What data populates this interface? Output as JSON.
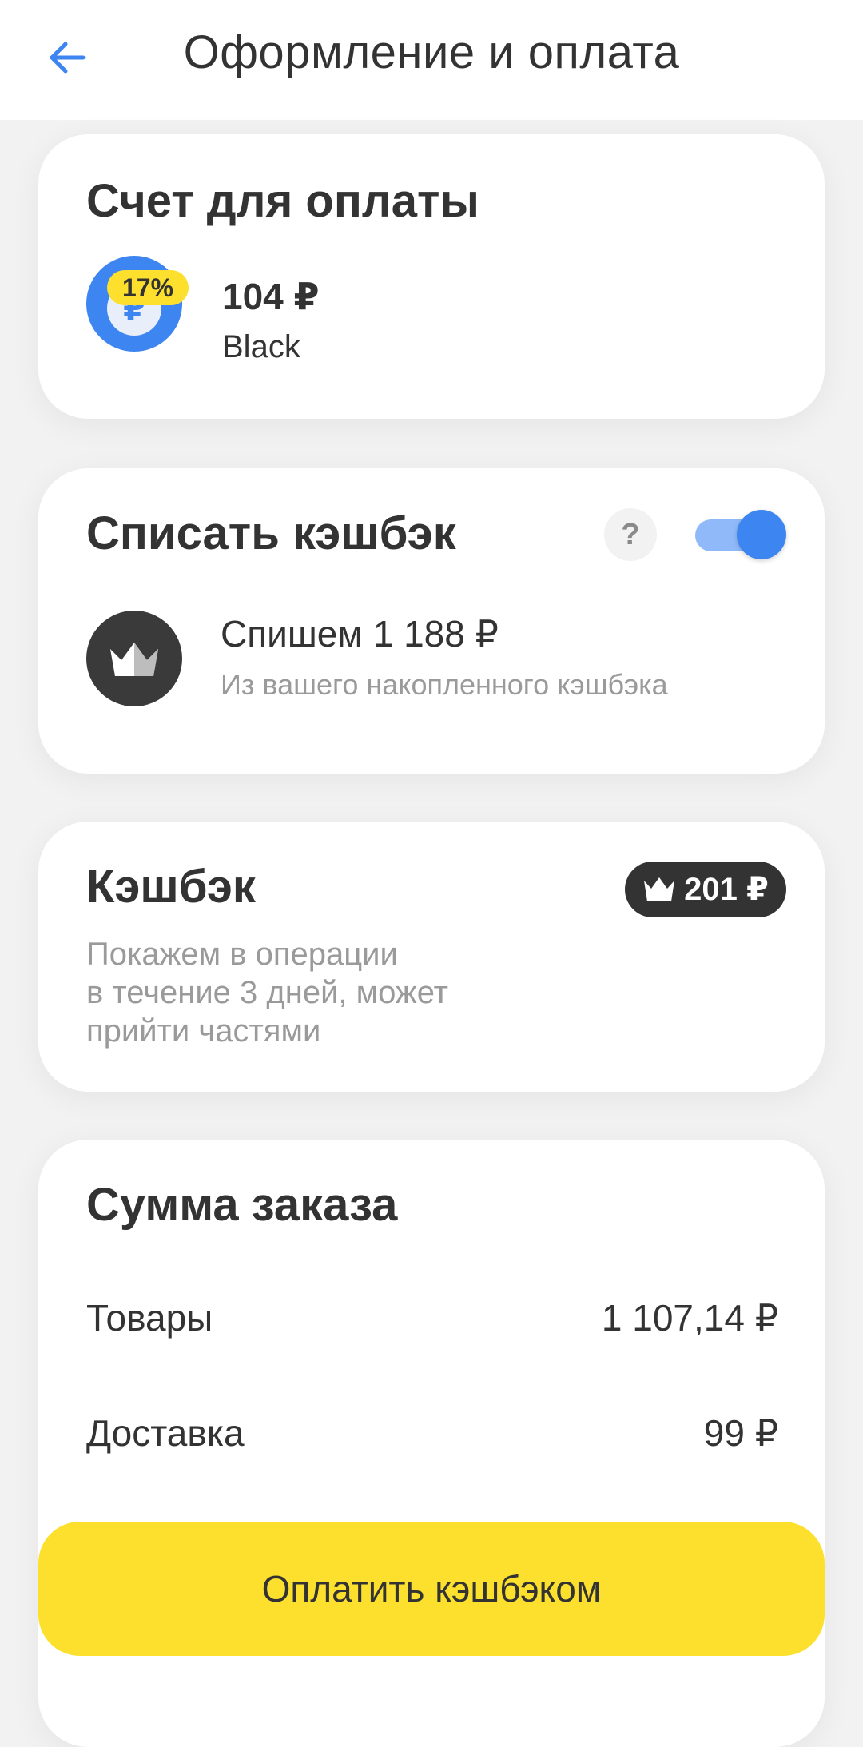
{
  "header": {
    "title": "Оформление и оплата",
    "back_icon": "arrow-left-icon"
  },
  "account_card": {
    "title": "Счет для оплаты",
    "badge": "17%",
    "currency_symbol": "₽",
    "amount": "104 ₽",
    "name": "Black"
  },
  "cashback_use_card": {
    "title": "Списать кэшбэк",
    "help": "?",
    "toggle_on": true,
    "line1": "Спишем 1 188 ₽",
    "line2": "Из вашего накопленного кэшбэка"
  },
  "cashback_card": {
    "title": "Кэшбэк",
    "badge_amount": "201 ₽",
    "description": [
      "Покажем в операции",
      "в течение 3 дней, может",
      "прийти частями"
    ]
  },
  "summary_card": {
    "title": "Сумма заказа",
    "rows": [
      {
        "label": "Товары",
        "value": "1 107,14 ₽"
      },
      {
        "label": "Доставка",
        "value": "99 ₽"
      }
    ]
  },
  "pay_button": {
    "label": "Оплатить кэшбэком"
  },
  "colors": {
    "accent_blue": "#3d85f0",
    "yellow": "#fde02e",
    "dark": "#333333"
  }
}
